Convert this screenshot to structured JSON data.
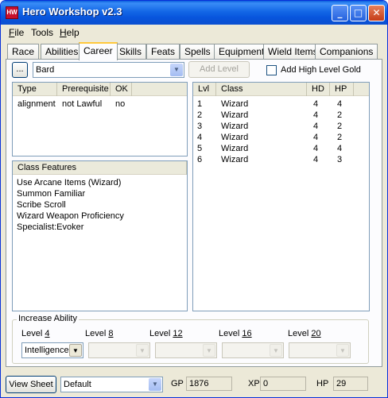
{
  "window": {
    "title": "Hero Workshop v2.3",
    "icon": "app-icon",
    "minimize": "_",
    "maximize": "□",
    "close": "✕"
  },
  "menu": [
    {
      "key": "F",
      "rest": "ile"
    },
    {
      "key": "",
      "rest": "Tools"
    },
    {
      "key": "H",
      "rest": "elp"
    }
  ],
  "tabs": [
    "Race",
    "Abilities",
    "Career",
    "Skills",
    "Feats",
    "Spells",
    "Equipment",
    "Wield Items",
    "Companions"
  ],
  "active_tab": "Career",
  "career": {
    "ellipsis_button": "...",
    "class_select": "Bard",
    "add_level_button": "Add Level",
    "high_level_gold_label": "Add High Level Gold",
    "high_level_gold_checked": false
  },
  "requirements": {
    "headers": [
      "Type",
      "Prerequisite",
      "OK"
    ],
    "rows": [
      [
        "alignment",
        "not Lawful",
        "no"
      ]
    ]
  },
  "class_features": {
    "header": "Class Features",
    "items": [
      "Use Arcane Items (Wizard)",
      "Summon Familiar",
      "Scribe Scroll",
      "Wizard Weapon Proficiency",
      "Specialist:Evoker"
    ]
  },
  "levels": {
    "headers": [
      "Lvl",
      "Class",
      "HD",
      "HP"
    ],
    "rows": [
      [
        "1",
        "Wizard",
        "4",
        "4"
      ],
      [
        "2",
        "Wizard",
        "4",
        "2"
      ],
      [
        "3",
        "Wizard",
        "4",
        "2"
      ],
      [
        "4",
        "Wizard",
        "4",
        "2"
      ],
      [
        "5",
        "Wizard",
        "4",
        "4"
      ],
      [
        "6",
        "Wizard",
        "4",
        "3"
      ]
    ]
  },
  "increase_ability": {
    "title": "Increase Ability",
    "levels": [
      {
        "prefix": "Level ",
        "num": "4",
        "value": "Intelligence",
        "enabled": true
      },
      {
        "prefix": "Level ",
        "num": "8",
        "value": "",
        "enabled": false
      },
      {
        "prefix": "Level ",
        "num": "12",
        "value": "",
        "enabled": false
      },
      {
        "prefix": "Level ",
        "num": "16",
        "value": "",
        "enabled": false
      },
      {
        "prefix": "Level ",
        "num": "20",
        "value": "",
        "enabled": false
      }
    ]
  },
  "status": {
    "view_sheet_button": "View Sheet",
    "sheet_select": "Default",
    "gp_label": "GP",
    "gp_value": "1876",
    "xp_label": "XP",
    "xp_value": "0",
    "hp_label": "HP",
    "hp_value": "29"
  }
}
